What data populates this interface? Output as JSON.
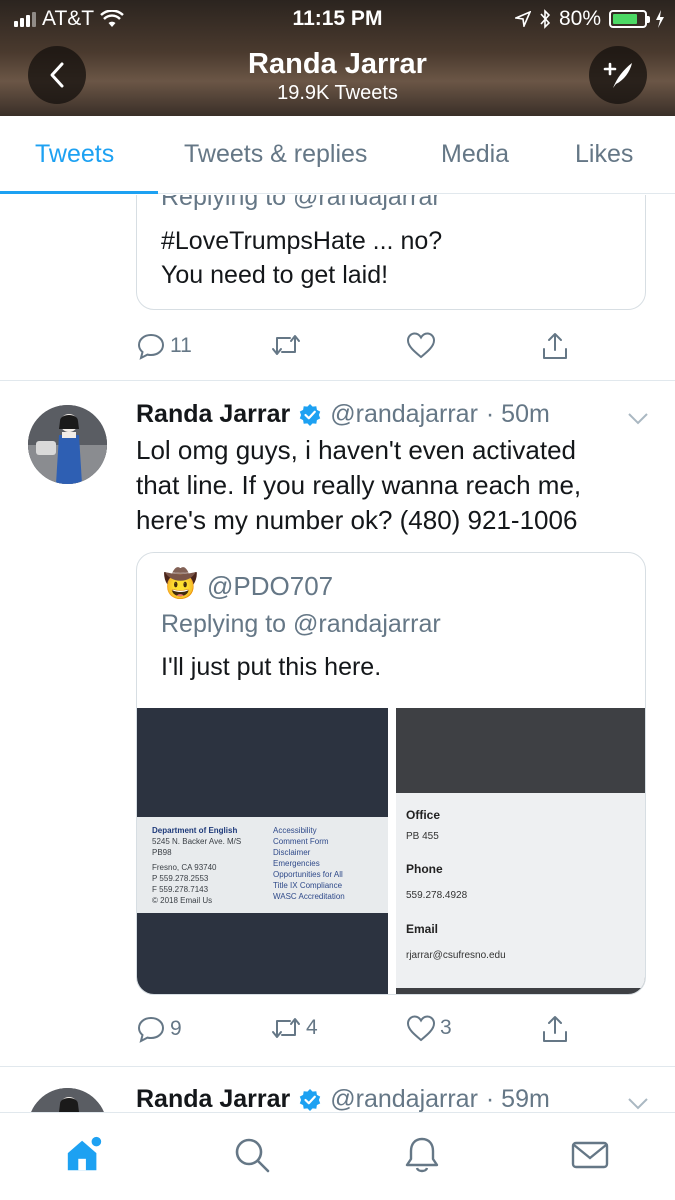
{
  "status": {
    "carrier": "AT&T",
    "time": "11:15 PM",
    "battery": "80%",
    "battery_level": 0.8
  },
  "header": {
    "name": "Randa Jarrar",
    "tweet_count": "19.9K Tweets"
  },
  "tabs": [
    {
      "label": "Tweets",
      "active": true
    },
    {
      "label": "Tweets & replies"
    },
    {
      "label": "Media"
    },
    {
      "label": "Likes"
    }
  ],
  "tweet1": {
    "quoted": {
      "replying": "Replying to @randajarrar",
      "line1": "#LoveTrumpsHate ... no?",
      "line2": "You need to get laid!"
    },
    "replies": "11",
    "retweets": "",
    "likes": ""
  },
  "tweet2": {
    "name": "Randa Jarrar",
    "handle": "@randajarrar",
    "time": "· 50m",
    "body_line1": "Lol omg guys, i haven't even activated",
    "body_line2": "that line. If you really wanna reach me,",
    "body_line3": "here's my number ok? (480) 921-1006",
    "quoted": {
      "emoji": "🤠",
      "handle": "@PDO707",
      "replying": "Replying to @randajarrar",
      "text": "I'll just put this here.",
      "footer": {
        "dept": "Department of English",
        "addr1": "5245 N. Backer Ave. M/S",
        "addr2": "PB98",
        "addr3": "Fresno, CA 93740",
        "phone": "P 559.278.2553",
        "fax": "F 559.278.7143",
        "copyright": "© 2018 Email Us",
        "links": [
          "Accessibility",
          "Comment Form",
          "Disclaimer",
          "Emergencies",
          "Opportunities for All",
          "Title IX Compliance",
          "WASC Accreditation"
        ]
      },
      "contact": {
        "office_label": "Office",
        "office_value": "PB 455",
        "phone_label": "Phone",
        "phone_value": "559.278.4928",
        "email_label": "Email",
        "email_value": "rjarrar@csufresno.edu"
      }
    },
    "replies": "9",
    "retweets": "4",
    "likes": "3"
  },
  "tweet3": {
    "name": "Randa Jarrar",
    "handle": "@randajarrar",
    "time": "· 59m"
  },
  "colors": {
    "accent": "#1da1f2",
    "muted": "#657786",
    "verified": "#1da1f2"
  },
  "icons": {
    "back": "chevron-left-icon",
    "compose": "compose-tweet-icon",
    "reply": "reply-icon",
    "retweet": "retweet-icon",
    "like": "heart-icon",
    "share": "share-icon",
    "home": "home-icon",
    "search": "search-icon",
    "notifications": "bell-icon",
    "messages": "mail-icon"
  }
}
